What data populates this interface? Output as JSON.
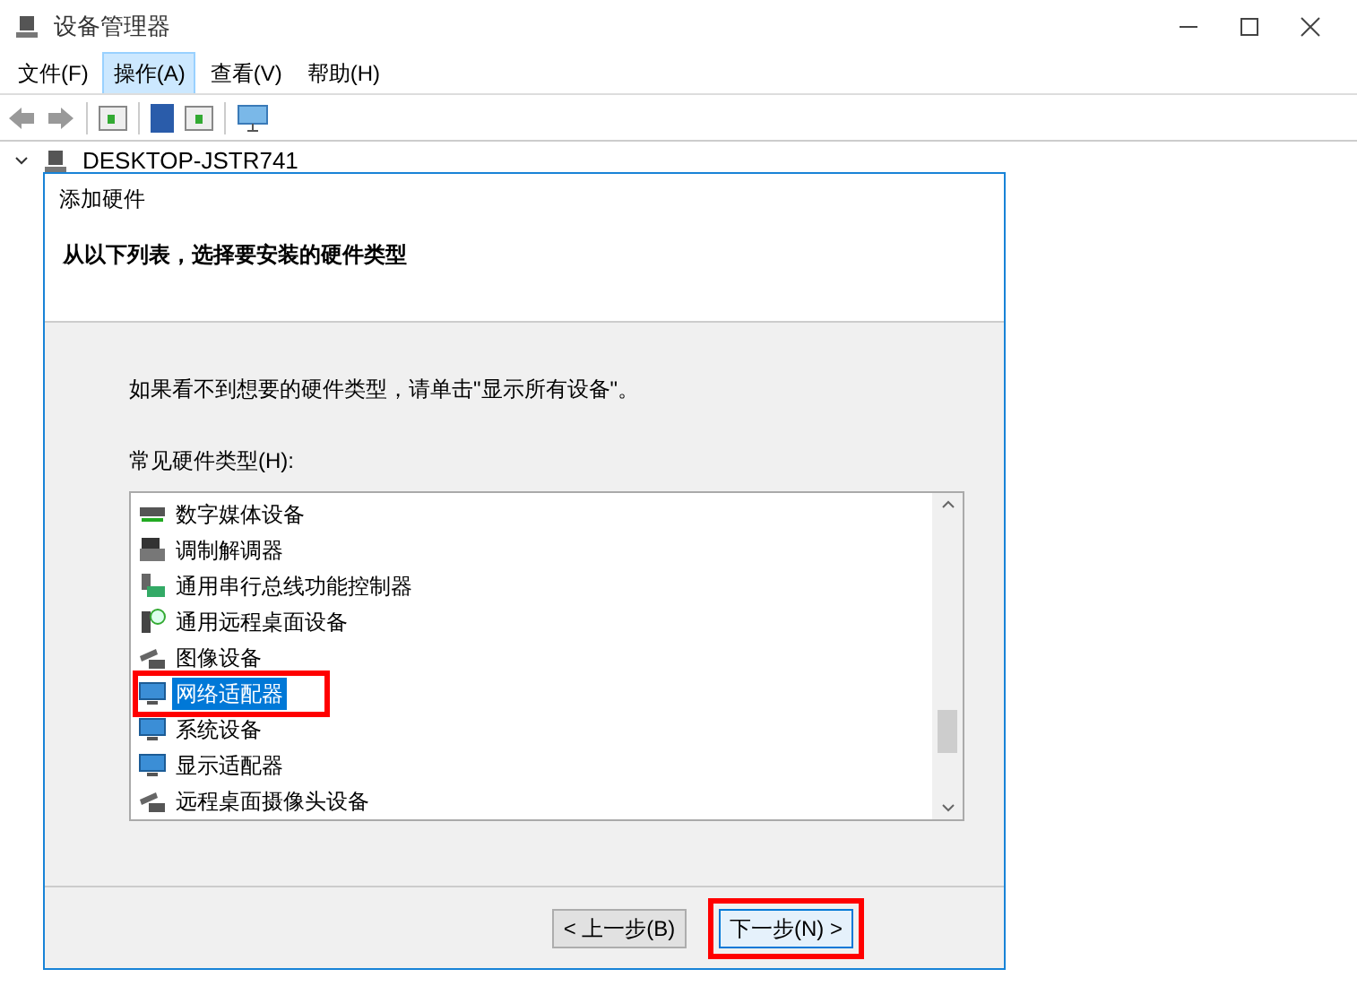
{
  "window": {
    "title": "设备管理器"
  },
  "menu": [
    {
      "label": "文件(F)",
      "selected": false
    },
    {
      "label": "操作(A)",
      "selected": true
    },
    {
      "label": "查看(V)",
      "selected": false
    },
    {
      "label": "帮助(H)",
      "selected": false
    }
  ],
  "tree": {
    "root": "DESKTOP-JSTR741",
    "expanded": true
  },
  "dialog": {
    "title": "添加硬件",
    "heading": "从以下列表，选择要安装的硬件类型",
    "hint": "如果看不到想要的硬件类型，请单击\"显示所有设备\"。",
    "list_label": "常见硬件类型(H):",
    "items": [
      {
        "label": "数字媒体设备",
        "kind": "media",
        "selected": false,
        "highlighted": false
      },
      {
        "label": "调制解调器",
        "kind": "modem",
        "selected": false,
        "highlighted": false
      },
      {
        "label": "通用串行总线功能控制器",
        "kind": "usb",
        "selected": false,
        "highlighted": false
      },
      {
        "label": "通用远程桌面设备",
        "kind": "remote",
        "selected": false,
        "highlighted": false
      },
      {
        "label": "图像设备",
        "kind": "camera",
        "selected": false,
        "highlighted": false
      },
      {
        "label": "网络适配器",
        "kind": "monitor",
        "selected": true,
        "highlighted": true
      },
      {
        "label": "系统设备",
        "kind": "monitor",
        "selected": false,
        "highlighted": false
      },
      {
        "label": "显示适配器",
        "kind": "monitor",
        "selected": false,
        "highlighted": false
      },
      {
        "label": "远程桌面摄像头设备",
        "kind": "camera",
        "selected": false,
        "highlighted": false
      }
    ],
    "buttons": [
      {
        "label": "< 上一步(B)",
        "default": false,
        "highlighted": false
      },
      {
        "label": "下一步(N) >",
        "default": true,
        "highlighted": true
      }
    ]
  }
}
